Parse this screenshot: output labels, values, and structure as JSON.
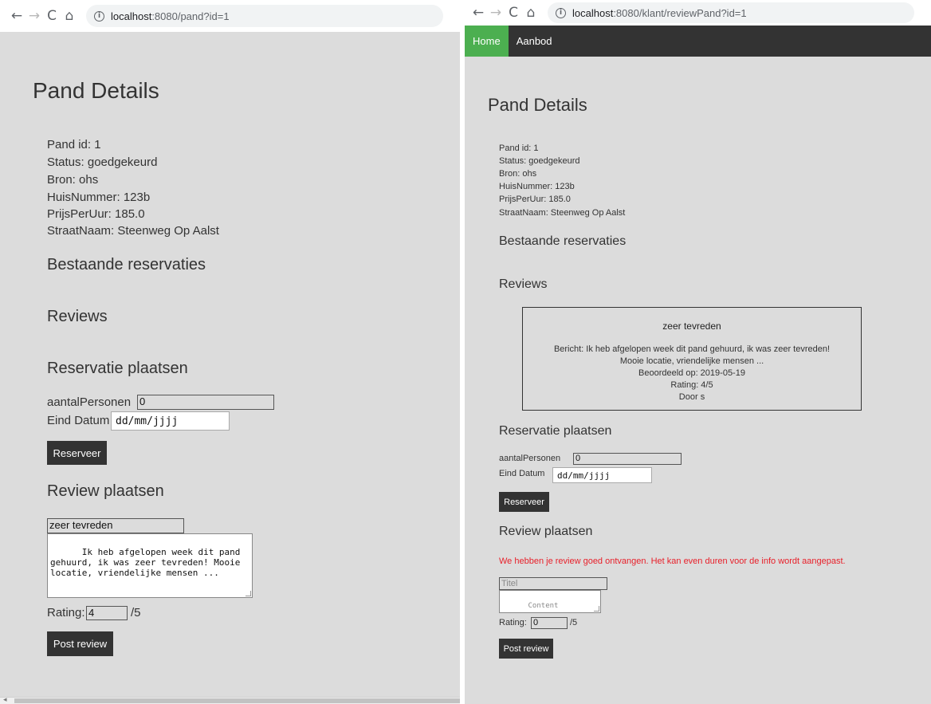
{
  "left": {
    "browser": {
      "back_icon": "←",
      "forward_icon": "→",
      "reload_icon": "C",
      "home_icon": "⌂",
      "info_icon": "i",
      "url_host": "localhost",
      "url_path": ":8080/pand?id=1"
    },
    "heading": "Pand Details",
    "details": [
      "Pand id: 1",
      "Status: goedgekeurd",
      "Bron: ohs",
      "HuisNummer: 123b",
      "PrijsPerUur: 185.0",
      "StraatNaam: Steenweg Op Aalst"
    ],
    "reservations_heading": "Bestaande reservaties",
    "reviews_heading": "Reviews",
    "reservation_form": {
      "heading": "Reservatie plaatsen",
      "persons_label": "aantalPersonen",
      "persons_value": "0",
      "date_label": "Eind Datum",
      "date_value": "dd/mm/jjjj",
      "submit_label": "Reserveer"
    },
    "review_form": {
      "heading": "Review plaatsen",
      "title_value": "zeer tevreden",
      "content_value": "Ik heb afgelopen week dit pand gehuurd, ik was zeer tevreden! Mooie locatie, vriendelijke mensen ...",
      "rating_label": "Rating:",
      "rating_value": "4",
      "rating_suffix": "/5",
      "submit_label": "Post review"
    }
  },
  "right": {
    "browser": {
      "back_icon": "←",
      "forward_icon": "→",
      "reload_icon": "C",
      "home_icon": "⌂",
      "info_icon": "i",
      "url_host": "localhost",
      "url_path": ":8080/klant/reviewPand?id=1"
    },
    "menu": {
      "home_label": "Home",
      "aanbod_label": "Aanbod",
      "active_color": "#4caf50",
      "bar_color": "#333333"
    },
    "heading": "Pand Details",
    "details": [
      "Pand id: 1",
      "Status: goedgekeurd",
      "Bron: ohs",
      "HuisNummer: 123b",
      "PrijsPerUur: 185.0",
      "StraatNaam: Steenweg Op Aalst"
    ],
    "reservations_heading": "Bestaande reservaties",
    "reviews_heading": "Reviews",
    "review_card": {
      "title": "zeer tevreden",
      "message_line1": "Bericht: Ik heb afgelopen week dit pand gehuurd, ik was zeer tevreden!",
      "message_line2": "Mooie locatie, vriendelijke mensen ...",
      "date_line": "Beoordeeld op: 2019-05-19",
      "rating_line": "Rating: 4/5",
      "author_line": "Door s"
    },
    "reservation_form": {
      "heading": "Reservatie plaatsen",
      "persons_label": "aantalPersonen",
      "persons_value": "0",
      "date_label": "Eind Datum",
      "date_value": "dd/mm/jjjj",
      "submit_label": "Reserveer"
    },
    "review_form": {
      "heading": "Review plaatsen",
      "success_message": "We hebben je review goed ontvangen. Het kan even duren voor de info wordt aangepast.",
      "success_color": "#e8202a",
      "title_placeholder": "Titel",
      "content_placeholder": "Content",
      "rating_label": "Rating:",
      "rating_value": "0",
      "rating_suffix": "/5",
      "submit_label": "Post review"
    }
  }
}
